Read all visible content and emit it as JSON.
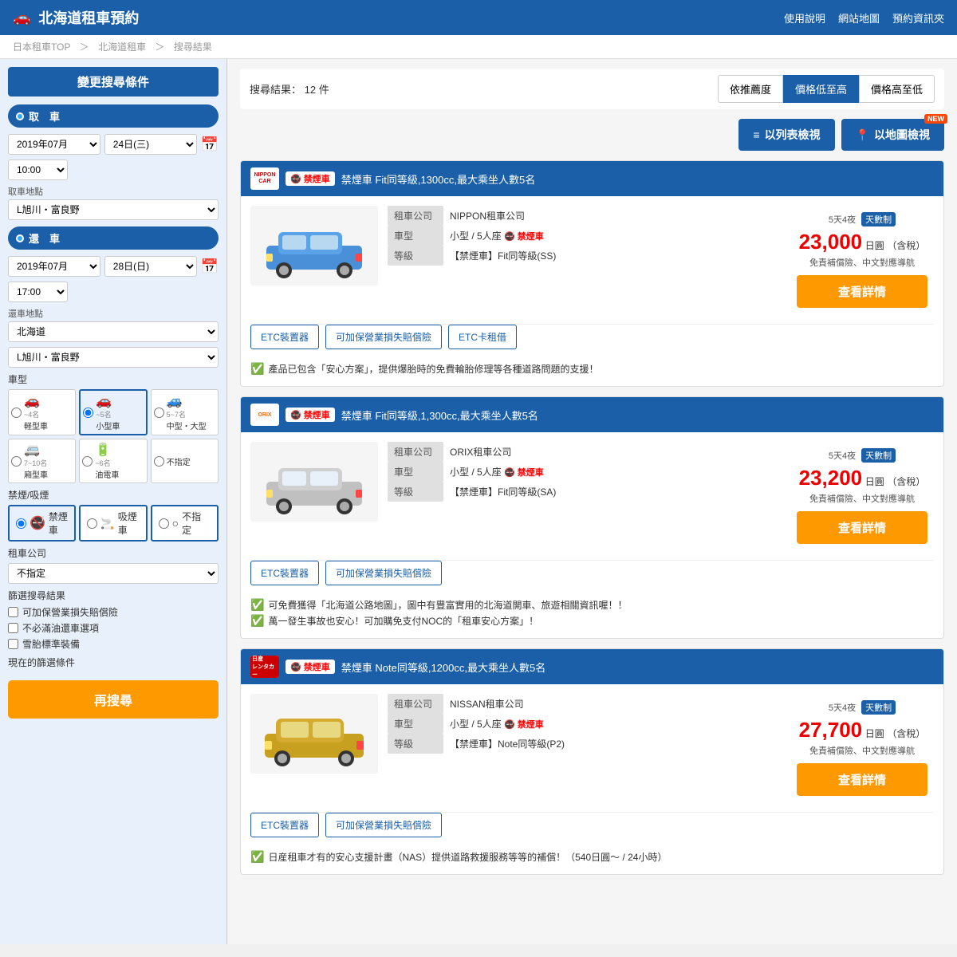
{
  "header": {
    "title": "北海道租車預約",
    "car_icon": "🚗",
    "links": [
      "使用說明",
      "網站地圖",
      "預約資訊夾"
    ]
  },
  "breadcrumb": {
    "items": [
      "日本租車TOP",
      "北海道租車",
      "搜尋結果"
    ]
  },
  "sidebar": {
    "title": "變更搜尋條件",
    "pickup_label": "取　車",
    "pickup_year_month": "2019年07月",
    "pickup_day": "24日(三)",
    "pickup_time": "10:00",
    "pickup_location_label": "取車地點",
    "pickup_location": "L旭川・富良野",
    "return_label": "還　車",
    "return_year_month": "2019年07月",
    "return_day": "28日(日)",
    "return_time": "17:00",
    "return_location_label": "還車地點",
    "return_prefecture": "北海道",
    "return_location": "L旭川・富良野",
    "car_type_label": "車型",
    "car_types": [
      {
        "id": "light",
        "label": "軽型車",
        "sublabel": "~4名",
        "icon": "🚗"
      },
      {
        "id": "small",
        "label": "小型車",
        "sublabel": "~5名",
        "icon": "🚗",
        "selected": true
      },
      {
        "id": "medium",
        "label": "中型・大型",
        "sublabel": "5~7名",
        "icon": "🚙"
      },
      {
        "id": "van",
        "label": "廂型車",
        "sublabel": "7~10名",
        "icon": "🚐"
      },
      {
        "id": "ev",
        "label": "油電車",
        "sublabel": "~6名",
        "icon": "🔋"
      },
      {
        "id": "any",
        "label": "不指定",
        "sublabel": "",
        "icon": ""
      }
    ],
    "smoke_label": "禁煙/吸煙",
    "smoke_options": [
      {
        "id": "no_smoke",
        "label": "禁煙車",
        "selected": true
      },
      {
        "id": "smoke",
        "label": "吸煙車"
      },
      {
        "id": "any",
        "label": "不指定"
      }
    ],
    "company_label": "租車公司",
    "company_value": "不指定",
    "filter_label": "篩選搜尋結果",
    "filters": [
      {
        "id": "insurance",
        "label": "可加保營業損失賠償險"
      },
      {
        "id": "no_oil",
        "label": "不必滿油還車選項"
      },
      {
        "id": "snow",
        "label": "雪胎標準裝備"
      }
    ],
    "current_filter_label": "現在的篩選條件",
    "search_btn_label": "再搜尋"
  },
  "content": {
    "result_count_label": "搜尋結果：",
    "result_count": "12",
    "result_unit": "件",
    "sort_buttons": [
      {
        "label": "依推薦度",
        "active": false
      },
      {
        "label": "價格低至高",
        "active": true
      },
      {
        "label": "價格高至低",
        "active": false
      }
    ],
    "view_buttons": [
      {
        "label": "以列表檢視",
        "icon": "≡"
      },
      {
        "label": "以地圖檢視",
        "icon": "📍",
        "badge": "NEW"
      }
    ],
    "cars": [
      {
        "id": 1,
        "company_type": "nippon",
        "no_smoke": true,
        "header_text": "禁煙車 Fit同等級,1300cc,最大乘坐人數5名",
        "company_name": "NIPPON租車公司",
        "car_type": "小型 / 5人座",
        "grade": "【禁煙車】Fit同等級(SS)",
        "days_label": "5天4夜",
        "days_badge": "天數制",
        "price": "23,000",
        "price_unit": "日圓",
        "price_note1": "（含稅）",
        "price_note2": "免責補償險、中文對應導航",
        "action_btns": [
          "ETC裝置器",
          "可加保營業損失賠償險",
          "ETC卡租借"
        ],
        "info_items": [
          "產品已包含「安心方案」，提供爆胎時的免費輪胎修理等各種道路問題的支援！"
        ],
        "detail_btn": "查看詳情"
      },
      {
        "id": 2,
        "company_type": "orix",
        "no_smoke": true,
        "header_text": "禁煙車 Fit同等級,1,300cc,最大乘坐人數5名",
        "company_name": "ORIX租車公司",
        "car_type": "小型 / 5人座",
        "grade": "【禁煙車】Fit同等級(SA)",
        "days_label": "5天4夜",
        "days_badge": "天數制",
        "price": "23,200",
        "price_unit": "日圓",
        "price_note1": "（含稅）",
        "price_note2": "免責補償險、中文對應導航",
        "action_btns": [
          "ETC裝置器",
          "可加保營業損失賠償險"
        ],
        "info_items": [
          "可免費獲得「北海道公路地圖」，圖中有豐富實用的北海道開車、旅遊相關資訊喔！！",
          "萬一發生事故也安心！可加購免支付NOC的「租車安心方案」！"
        ],
        "detail_btn": "查看詳情"
      },
      {
        "id": 3,
        "company_type": "nissan",
        "no_smoke": true,
        "header_text": "禁煙車 Note同等級,1200cc,最大乘坐人數5名",
        "company_name": "NISSAN租車公司",
        "car_type": "小型 / 5人座",
        "grade": "【禁煙車】Note同等級(P2)",
        "days_label": "5天4夜",
        "days_badge": "天數制",
        "price": "27,700",
        "price_unit": "日圓",
        "price_note1": "（含稅）",
        "price_note2": "免責補償險、中文對應導航",
        "action_btns": [
          "ETC裝置器",
          "可加保營業損失賠償險"
        ],
        "info_items": [
          "日産租車才有的安心支援計畫（NAS）提供道路救援服務等等的補償！（540日圓～ / 24小時）"
        ],
        "detail_btn": "查看詳情"
      }
    ]
  }
}
